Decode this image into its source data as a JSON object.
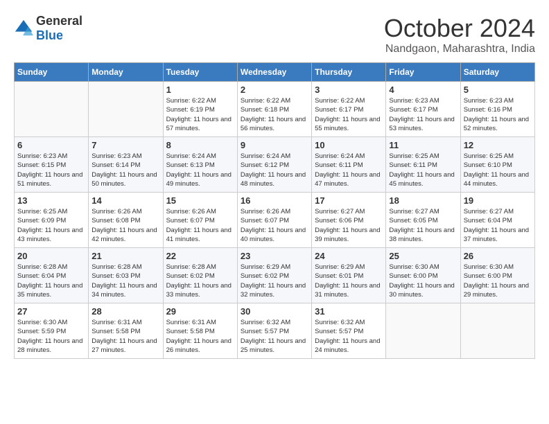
{
  "logo": {
    "general": "General",
    "blue": "Blue"
  },
  "header": {
    "month": "October 2024",
    "location": "Nandgaon, Maharashtra, India"
  },
  "columns": [
    "Sunday",
    "Monday",
    "Tuesday",
    "Wednesday",
    "Thursday",
    "Friday",
    "Saturday"
  ],
  "weeks": [
    [
      {
        "day": "",
        "sunrise": "",
        "sunset": "",
        "daylight": ""
      },
      {
        "day": "",
        "sunrise": "",
        "sunset": "",
        "daylight": ""
      },
      {
        "day": "1",
        "sunrise": "Sunrise: 6:22 AM",
        "sunset": "Sunset: 6:19 PM",
        "daylight": "Daylight: 11 hours and 57 minutes."
      },
      {
        "day": "2",
        "sunrise": "Sunrise: 6:22 AM",
        "sunset": "Sunset: 6:18 PM",
        "daylight": "Daylight: 11 hours and 56 minutes."
      },
      {
        "day": "3",
        "sunrise": "Sunrise: 6:22 AM",
        "sunset": "Sunset: 6:17 PM",
        "daylight": "Daylight: 11 hours and 55 minutes."
      },
      {
        "day": "4",
        "sunrise": "Sunrise: 6:23 AM",
        "sunset": "Sunset: 6:17 PM",
        "daylight": "Daylight: 11 hours and 53 minutes."
      },
      {
        "day": "5",
        "sunrise": "Sunrise: 6:23 AM",
        "sunset": "Sunset: 6:16 PM",
        "daylight": "Daylight: 11 hours and 52 minutes."
      }
    ],
    [
      {
        "day": "6",
        "sunrise": "Sunrise: 6:23 AM",
        "sunset": "Sunset: 6:15 PM",
        "daylight": "Daylight: 11 hours and 51 minutes."
      },
      {
        "day": "7",
        "sunrise": "Sunrise: 6:23 AM",
        "sunset": "Sunset: 6:14 PM",
        "daylight": "Daylight: 11 hours and 50 minutes."
      },
      {
        "day": "8",
        "sunrise": "Sunrise: 6:24 AM",
        "sunset": "Sunset: 6:13 PM",
        "daylight": "Daylight: 11 hours and 49 minutes."
      },
      {
        "day": "9",
        "sunrise": "Sunrise: 6:24 AM",
        "sunset": "Sunset: 6:12 PM",
        "daylight": "Daylight: 11 hours and 48 minutes."
      },
      {
        "day": "10",
        "sunrise": "Sunrise: 6:24 AM",
        "sunset": "Sunset: 6:11 PM",
        "daylight": "Daylight: 11 hours and 47 minutes."
      },
      {
        "day": "11",
        "sunrise": "Sunrise: 6:25 AM",
        "sunset": "Sunset: 6:11 PM",
        "daylight": "Daylight: 11 hours and 45 minutes."
      },
      {
        "day": "12",
        "sunrise": "Sunrise: 6:25 AM",
        "sunset": "Sunset: 6:10 PM",
        "daylight": "Daylight: 11 hours and 44 minutes."
      }
    ],
    [
      {
        "day": "13",
        "sunrise": "Sunrise: 6:25 AM",
        "sunset": "Sunset: 6:09 PM",
        "daylight": "Daylight: 11 hours and 43 minutes."
      },
      {
        "day": "14",
        "sunrise": "Sunrise: 6:26 AM",
        "sunset": "Sunset: 6:08 PM",
        "daylight": "Daylight: 11 hours and 42 minutes."
      },
      {
        "day": "15",
        "sunrise": "Sunrise: 6:26 AM",
        "sunset": "Sunset: 6:07 PM",
        "daylight": "Daylight: 11 hours and 41 minutes."
      },
      {
        "day": "16",
        "sunrise": "Sunrise: 6:26 AM",
        "sunset": "Sunset: 6:07 PM",
        "daylight": "Daylight: 11 hours and 40 minutes."
      },
      {
        "day": "17",
        "sunrise": "Sunrise: 6:27 AM",
        "sunset": "Sunset: 6:06 PM",
        "daylight": "Daylight: 11 hours and 39 minutes."
      },
      {
        "day": "18",
        "sunrise": "Sunrise: 6:27 AM",
        "sunset": "Sunset: 6:05 PM",
        "daylight": "Daylight: 11 hours and 38 minutes."
      },
      {
        "day": "19",
        "sunrise": "Sunrise: 6:27 AM",
        "sunset": "Sunset: 6:04 PM",
        "daylight": "Daylight: 11 hours and 37 minutes."
      }
    ],
    [
      {
        "day": "20",
        "sunrise": "Sunrise: 6:28 AM",
        "sunset": "Sunset: 6:04 PM",
        "daylight": "Daylight: 11 hours and 35 minutes."
      },
      {
        "day": "21",
        "sunrise": "Sunrise: 6:28 AM",
        "sunset": "Sunset: 6:03 PM",
        "daylight": "Daylight: 11 hours and 34 minutes."
      },
      {
        "day": "22",
        "sunrise": "Sunrise: 6:28 AM",
        "sunset": "Sunset: 6:02 PM",
        "daylight": "Daylight: 11 hours and 33 minutes."
      },
      {
        "day": "23",
        "sunrise": "Sunrise: 6:29 AM",
        "sunset": "Sunset: 6:02 PM",
        "daylight": "Daylight: 11 hours and 32 minutes."
      },
      {
        "day": "24",
        "sunrise": "Sunrise: 6:29 AM",
        "sunset": "Sunset: 6:01 PM",
        "daylight": "Daylight: 11 hours and 31 minutes."
      },
      {
        "day": "25",
        "sunrise": "Sunrise: 6:30 AM",
        "sunset": "Sunset: 6:00 PM",
        "daylight": "Daylight: 11 hours and 30 minutes."
      },
      {
        "day": "26",
        "sunrise": "Sunrise: 6:30 AM",
        "sunset": "Sunset: 6:00 PM",
        "daylight": "Daylight: 11 hours and 29 minutes."
      }
    ],
    [
      {
        "day": "27",
        "sunrise": "Sunrise: 6:30 AM",
        "sunset": "Sunset: 5:59 PM",
        "daylight": "Daylight: 11 hours and 28 minutes."
      },
      {
        "day": "28",
        "sunrise": "Sunrise: 6:31 AM",
        "sunset": "Sunset: 5:58 PM",
        "daylight": "Daylight: 11 hours and 27 minutes."
      },
      {
        "day": "29",
        "sunrise": "Sunrise: 6:31 AM",
        "sunset": "Sunset: 5:58 PM",
        "daylight": "Daylight: 11 hours and 26 minutes."
      },
      {
        "day": "30",
        "sunrise": "Sunrise: 6:32 AM",
        "sunset": "Sunset: 5:57 PM",
        "daylight": "Daylight: 11 hours and 25 minutes."
      },
      {
        "day": "31",
        "sunrise": "Sunrise: 6:32 AM",
        "sunset": "Sunset: 5:57 PM",
        "daylight": "Daylight: 11 hours and 24 minutes."
      },
      {
        "day": "",
        "sunrise": "",
        "sunset": "",
        "daylight": ""
      },
      {
        "day": "",
        "sunrise": "",
        "sunset": "",
        "daylight": ""
      }
    ]
  ]
}
